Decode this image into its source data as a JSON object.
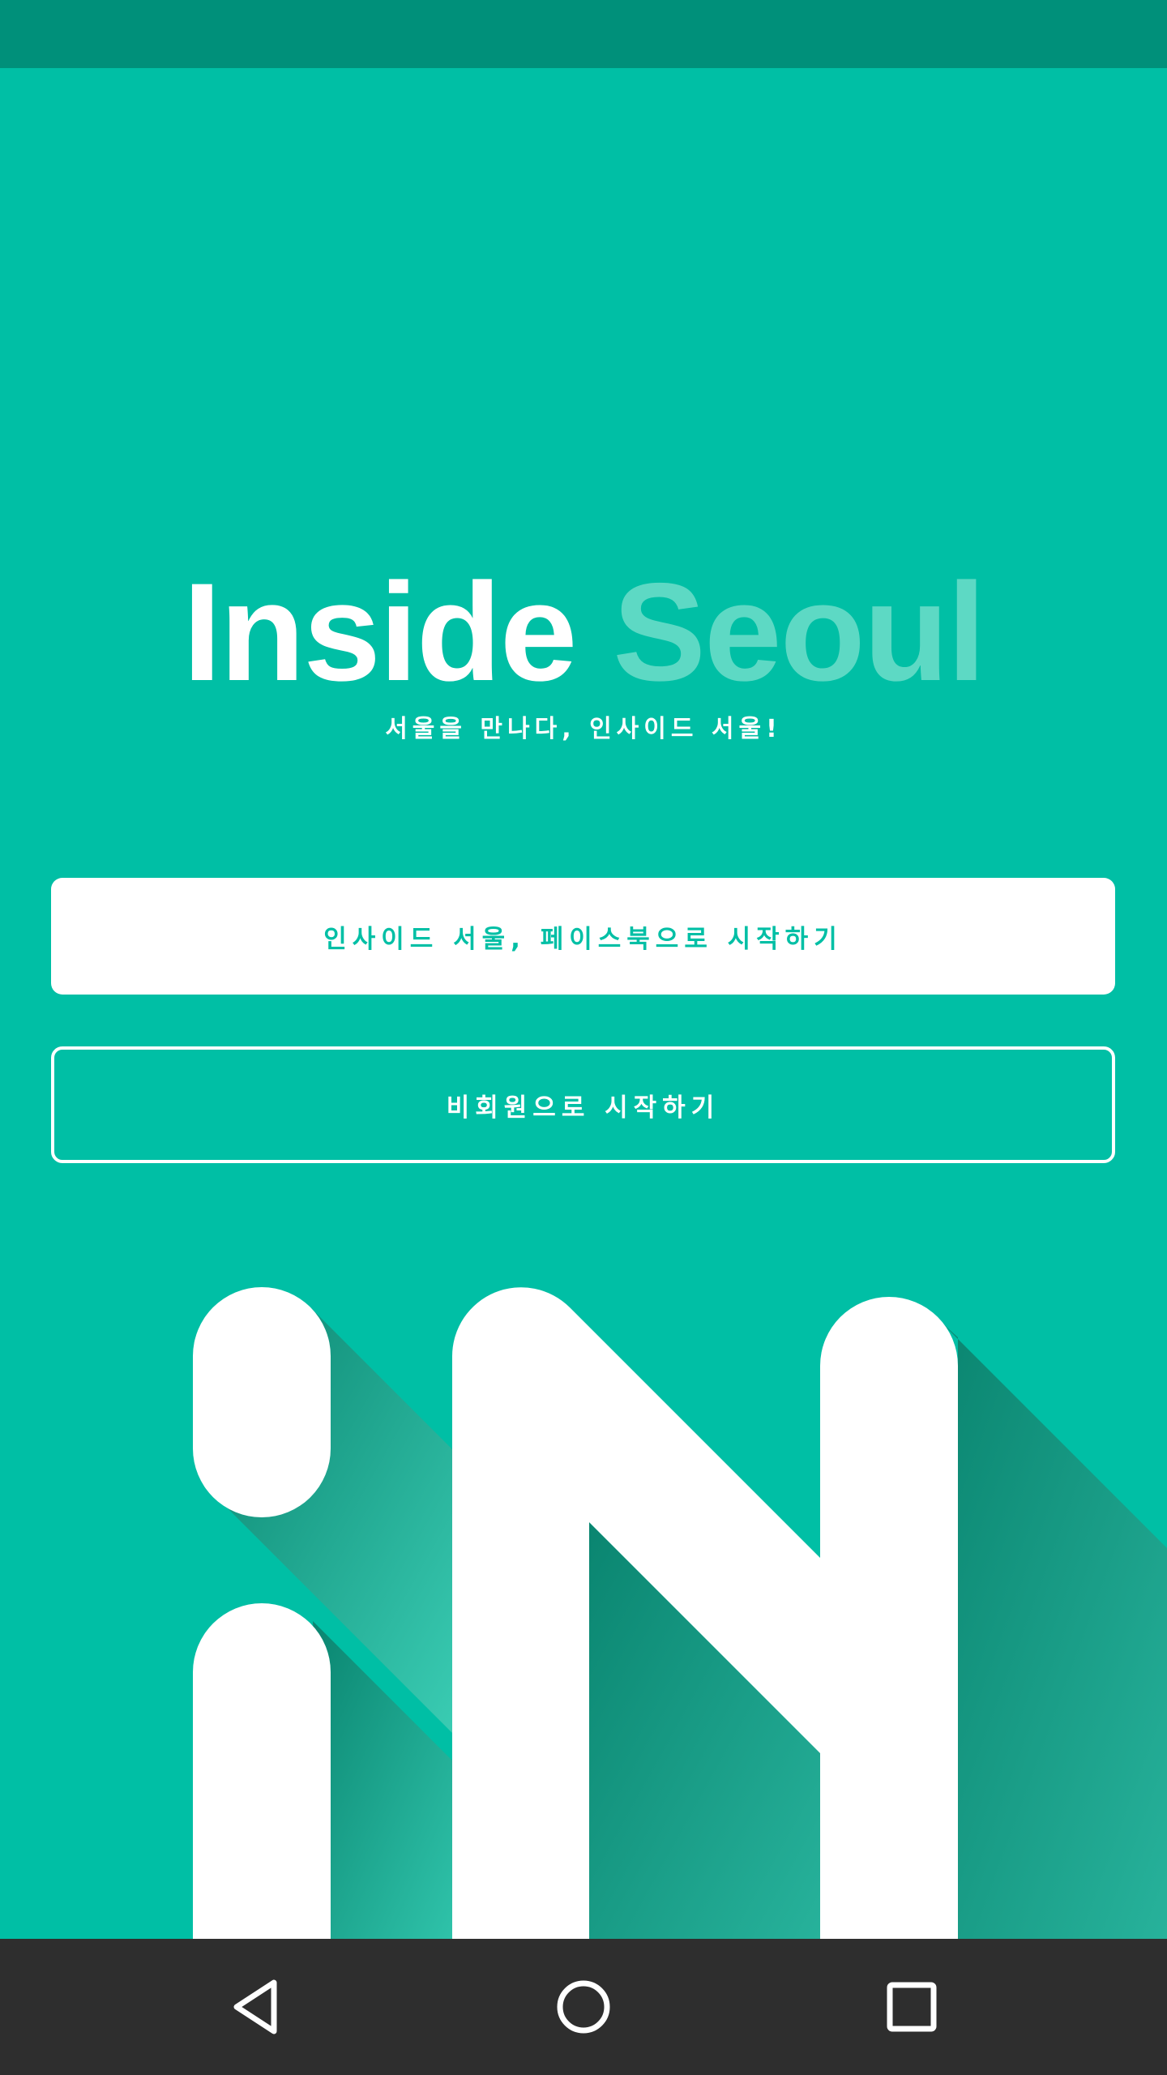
{
  "status_bar": {},
  "title": {
    "part1": "Inside",
    "part2": "Seoul"
  },
  "subtitle": "서울을 만나다, 인사이드 서울!",
  "buttons": {
    "facebook_label": "인사이드 서울, 페이스북으로 시작하기",
    "guest_label": "비회원으로 시작하기"
  },
  "logo": {
    "icon": "in-logo-icon"
  },
  "nav_bar": {
    "back_icon": "back-triangle-icon",
    "home_icon": "home-circle-icon",
    "recents_icon": "recents-square-icon"
  },
  "colors": {
    "background": "#00BFA5",
    "status_bar": "#00907A",
    "title_accent": "#5DD9C4",
    "nav_bar": "#2E2E2E",
    "white": "#FFFFFF"
  }
}
